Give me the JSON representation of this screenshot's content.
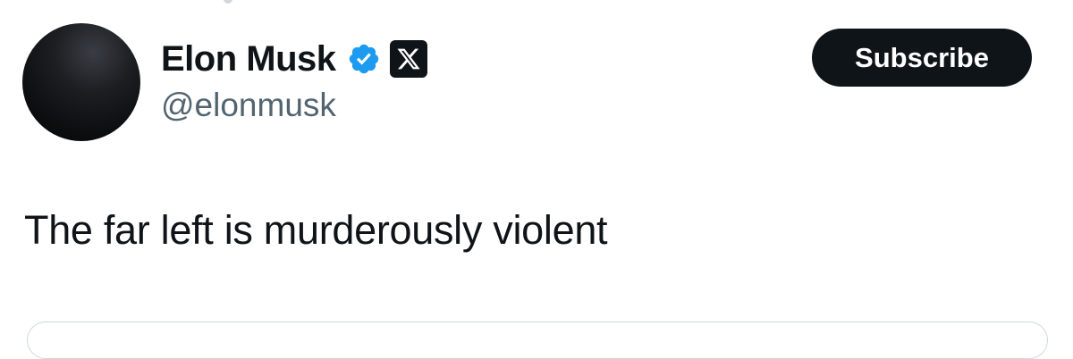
{
  "author": {
    "display_name": "Elon Musk",
    "handle": "@elonmusk",
    "verified_icon": "verified-badge-icon",
    "affiliate_icon": "x-logo-icon"
  },
  "actions": {
    "subscribe_label": "Subscribe"
  },
  "tweet": {
    "text": "The far left is murderously violent"
  },
  "colors": {
    "text_primary": "#0f1419",
    "text_secondary": "#536471",
    "verified_blue": "#1d9bf0",
    "button_bg": "#0f1419",
    "border": "#cfd9de"
  }
}
